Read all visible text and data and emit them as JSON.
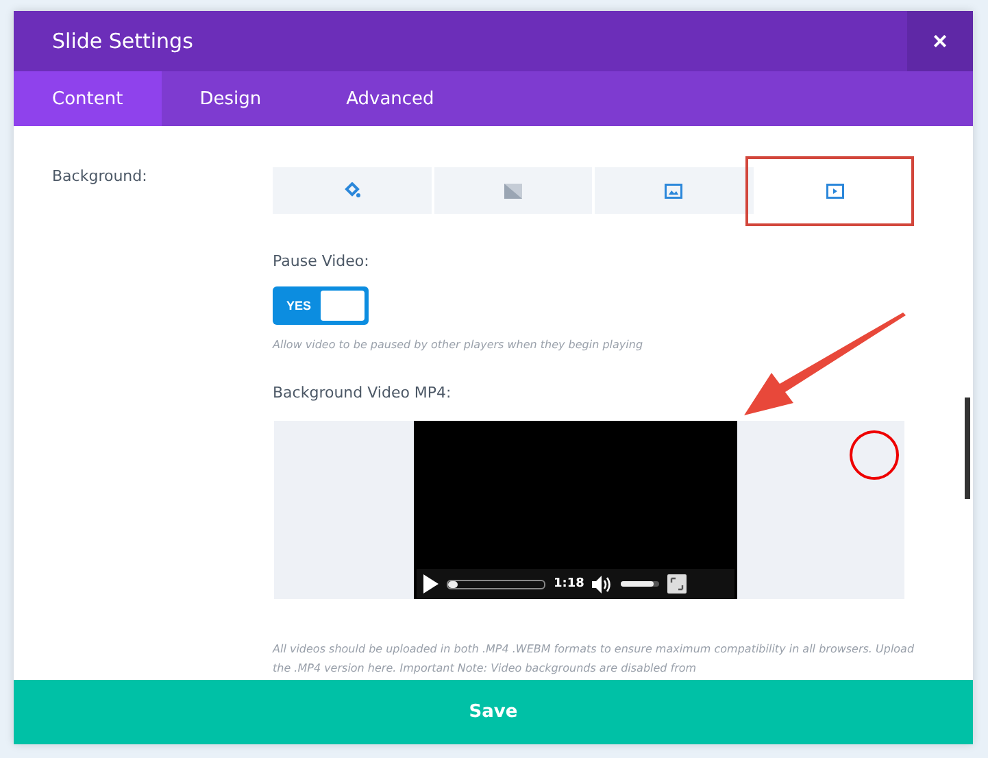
{
  "window": {
    "title": "Slide Settings",
    "close": "×"
  },
  "tabs": [
    {
      "label": "Content",
      "selected": true
    },
    {
      "label": "Design",
      "selected": false
    },
    {
      "label": "Advanced",
      "selected": false
    }
  ],
  "background": {
    "label": "Background:",
    "options": [
      {
        "kind": "color",
        "selected": false
      },
      {
        "kind": "gradient",
        "selected": false
      },
      {
        "kind": "image",
        "selected": false
      },
      {
        "kind": "video",
        "selected": true
      }
    ]
  },
  "pause_video": {
    "label": "Pause Video:",
    "on": true,
    "toggle_text": "YES",
    "help": "Allow video to be paused by other players when they begin playing"
  },
  "video_mp4": {
    "label": "Background Video MP4:",
    "player": {
      "time": "1:18",
      "progress": {
        "level": 0.1
      },
      "volume": {
        "level": 0.85
      }
    },
    "help": "All videos should be uploaded in both .MP4 .WEBM formats to ensure maximum compatibility in all browsers. Upload the .MP4 version here. Important Note: Video backgrounds are disabled from"
  },
  "save": "Save"
}
